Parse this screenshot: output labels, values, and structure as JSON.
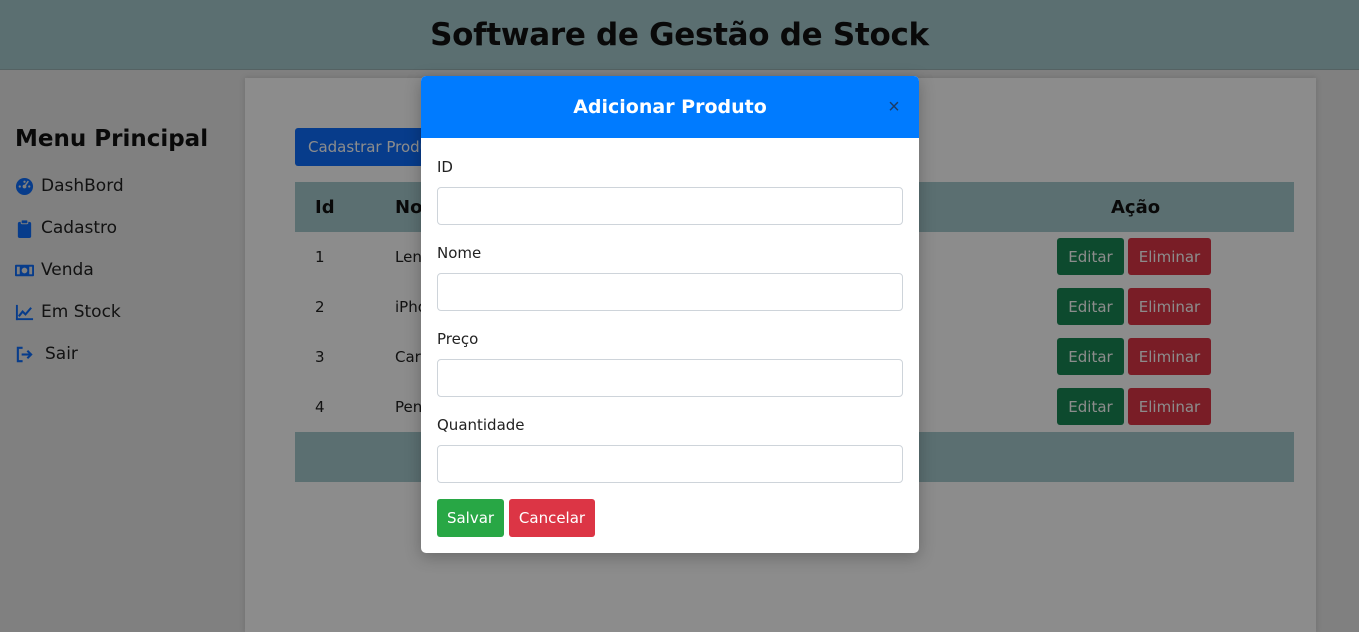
{
  "header": {
    "title": "Software de Gestão de Stock"
  },
  "sidebar": {
    "title": "Menu Principal",
    "items": [
      {
        "label": "DashBord",
        "icon": "dashboard-gauge-icon"
      },
      {
        "label": "Cadastro",
        "icon": "clipboard-icon"
      },
      {
        "label": "Venda",
        "icon": "money-bill-icon"
      },
      {
        "label": "Em Stock",
        "icon": "chart-line-icon"
      },
      {
        "label": "Sair",
        "icon": "sign-out-icon"
      }
    ]
  },
  "main": {
    "add_button_label": "Cadastrar Produto",
    "table": {
      "headers": {
        "id": "Id",
        "name": "Nome",
        "action": "Ação"
      },
      "rows": [
        {
          "id": "1",
          "name": "Lenovo"
        },
        {
          "id": "2",
          "name": "iPhone"
        },
        {
          "id": "3",
          "name": "Carteira"
        },
        {
          "id": "4",
          "name": "Pen"
        }
      ],
      "edit_label": "Editar",
      "delete_label": "Eliminar"
    }
  },
  "modal": {
    "title": "Adicionar Produto",
    "close_glyph": "×",
    "fields": {
      "id_label": "ID",
      "name_label": "Nome",
      "price_label": "Preço",
      "quantity_label": "Quantidade"
    },
    "save_label": "Salvar",
    "cancel_label": "Cancelar"
  },
  "colors": {
    "header_bg": "#a7cace",
    "primary": "#0d6efd",
    "modal_header": "#007bff",
    "success": "#28a745",
    "danger": "#dc3545"
  }
}
